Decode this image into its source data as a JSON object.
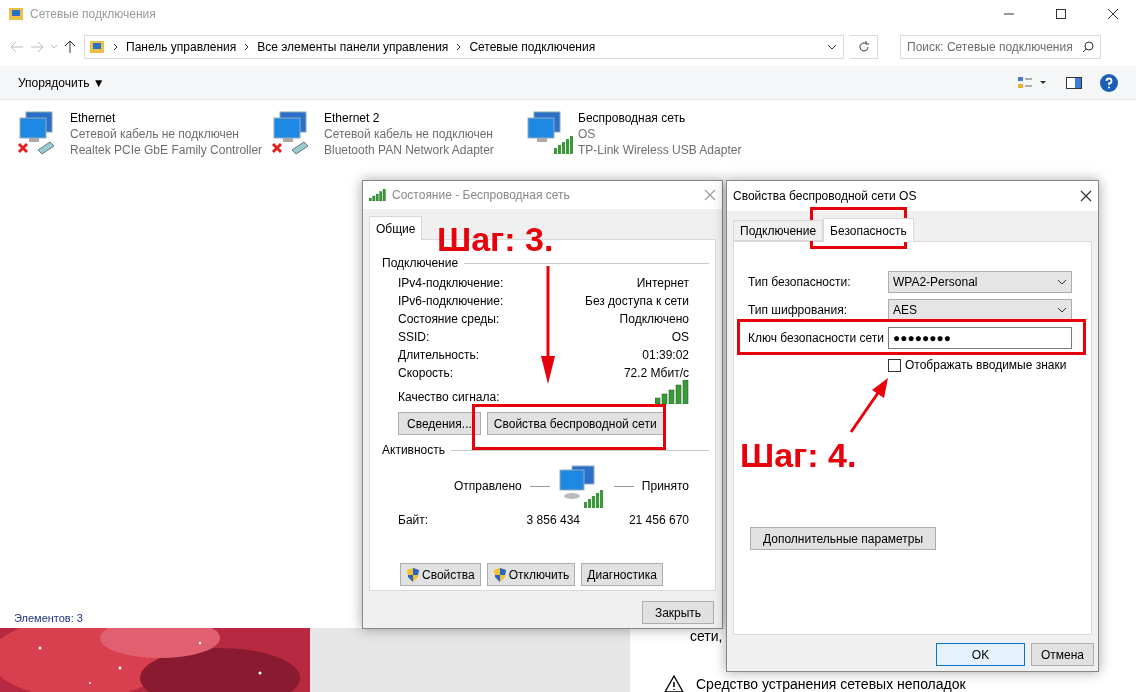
{
  "explorer": {
    "title": "Сетевые подключения",
    "breadcrumbs": [
      "Панель управления",
      "Все элементы панели управления",
      "Сетевые подключения"
    ],
    "search": {
      "placeholder": "Поиск: Сетевые подключения"
    },
    "organize": "Упорядочить ▼",
    "items": [
      {
        "name": "Ethernet",
        "status": "Сетевой кабель не подключен",
        "adapter": "Realtek PCIe GbE Family Controller",
        "kind": "wired"
      },
      {
        "name": "Ethernet 2",
        "status": "Сетевой кабель не подключен",
        "adapter": "Bluetooth PAN Network Adapter",
        "kind": "wired"
      },
      {
        "name": "Беспроводная сеть",
        "status": "OS",
        "adapter": "TP-Link Wireless USB Adapter",
        "kind": "wireless"
      }
    ],
    "status_bar": "Элементов: 3"
  },
  "desktop": {
    "settings_texts": [
      "сети,",
      "Средство устранения сетевых неполадок"
    ]
  },
  "status_dialog": {
    "title": "Состояние - Беспроводная сеть",
    "tabs": [
      {
        "label": "Общие",
        "selected": true
      }
    ],
    "connection_heading": "Подключение",
    "rows": [
      {
        "label": "IPv4-подключение:",
        "value": "Интернет"
      },
      {
        "label": "IPv6-подключение:",
        "value": "Без доступа к сети"
      },
      {
        "label": "Состояние среды:",
        "value": "Подключено"
      },
      {
        "label": "SSID:",
        "value": "OS"
      },
      {
        "label": "Длительность:",
        "value": "01:39:02"
      },
      {
        "label": "Скорость:",
        "value": "72.2 Мбит/с"
      }
    ],
    "signal_label": "Качество сигнала:",
    "details_button": "Сведения...",
    "wireless_props_button": "Свойства беспроводной сети",
    "activity_heading": "Активность",
    "sent_label": "Отправлено",
    "received_label": "Принято",
    "bytes_label": "Байт:",
    "sent": "3 856 434",
    "received": "21 456 670",
    "actions": [
      {
        "label": "Свойства",
        "shield": true
      },
      {
        "label": "Отключить",
        "shield": true
      },
      {
        "label": "Диагностика",
        "shield": false
      }
    ],
    "close_button": "Закрыть"
  },
  "props_dialog": {
    "title": "Свойства беспроводной сети OS",
    "tabs": [
      {
        "label": "Подключение",
        "selected": false
      },
      {
        "label": "Безопасность",
        "selected": true
      }
    ],
    "fields": [
      {
        "label": "Тип безопасности:",
        "kind": "select",
        "value": "WPA2-Personal"
      },
      {
        "label": "Тип шифрования:",
        "kind": "select",
        "value": "AES"
      },
      {
        "label": "Ключ безопасности сети",
        "kind": "password",
        "value": "●●●●●●●●"
      }
    ],
    "show_chars": {
      "label": "Отображать вводимые знаки",
      "checked": false
    },
    "advanced_button": "Дополнительные параметры",
    "ok_button": "OK",
    "cancel_button": "Отмена"
  },
  "annotations": [
    {
      "text": "Шаг: 3."
    },
    {
      "text": "Шаг: 4."
    }
  ]
}
